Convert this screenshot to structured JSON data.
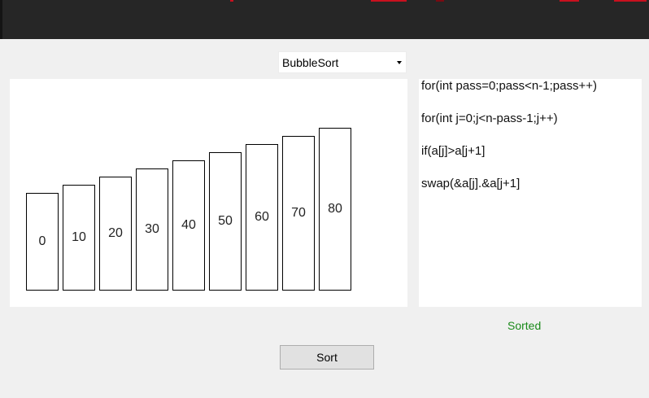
{
  "algorithm_select": {
    "selected": "BubbleSort"
  },
  "array": {
    "values": [
      0,
      10,
      20,
      30,
      40,
      50,
      60,
      70,
      80
    ]
  },
  "code": {
    "lines": [
      "for(int pass=0;pass<n-1;pass++)",
      "for(int j=0;j<n-pass-1;j++)",
      "if(a[j]>a[j+1]",
      "swap(&a[j].&a[j+1]"
    ]
  },
  "status": {
    "text": "Sorted",
    "color": "#1a8a1a"
  },
  "sort_button": {
    "label": "Sort"
  },
  "colors": {
    "titlebar": "#262626",
    "accent": "#c8101e",
    "background": "#f0f0f0"
  }
}
